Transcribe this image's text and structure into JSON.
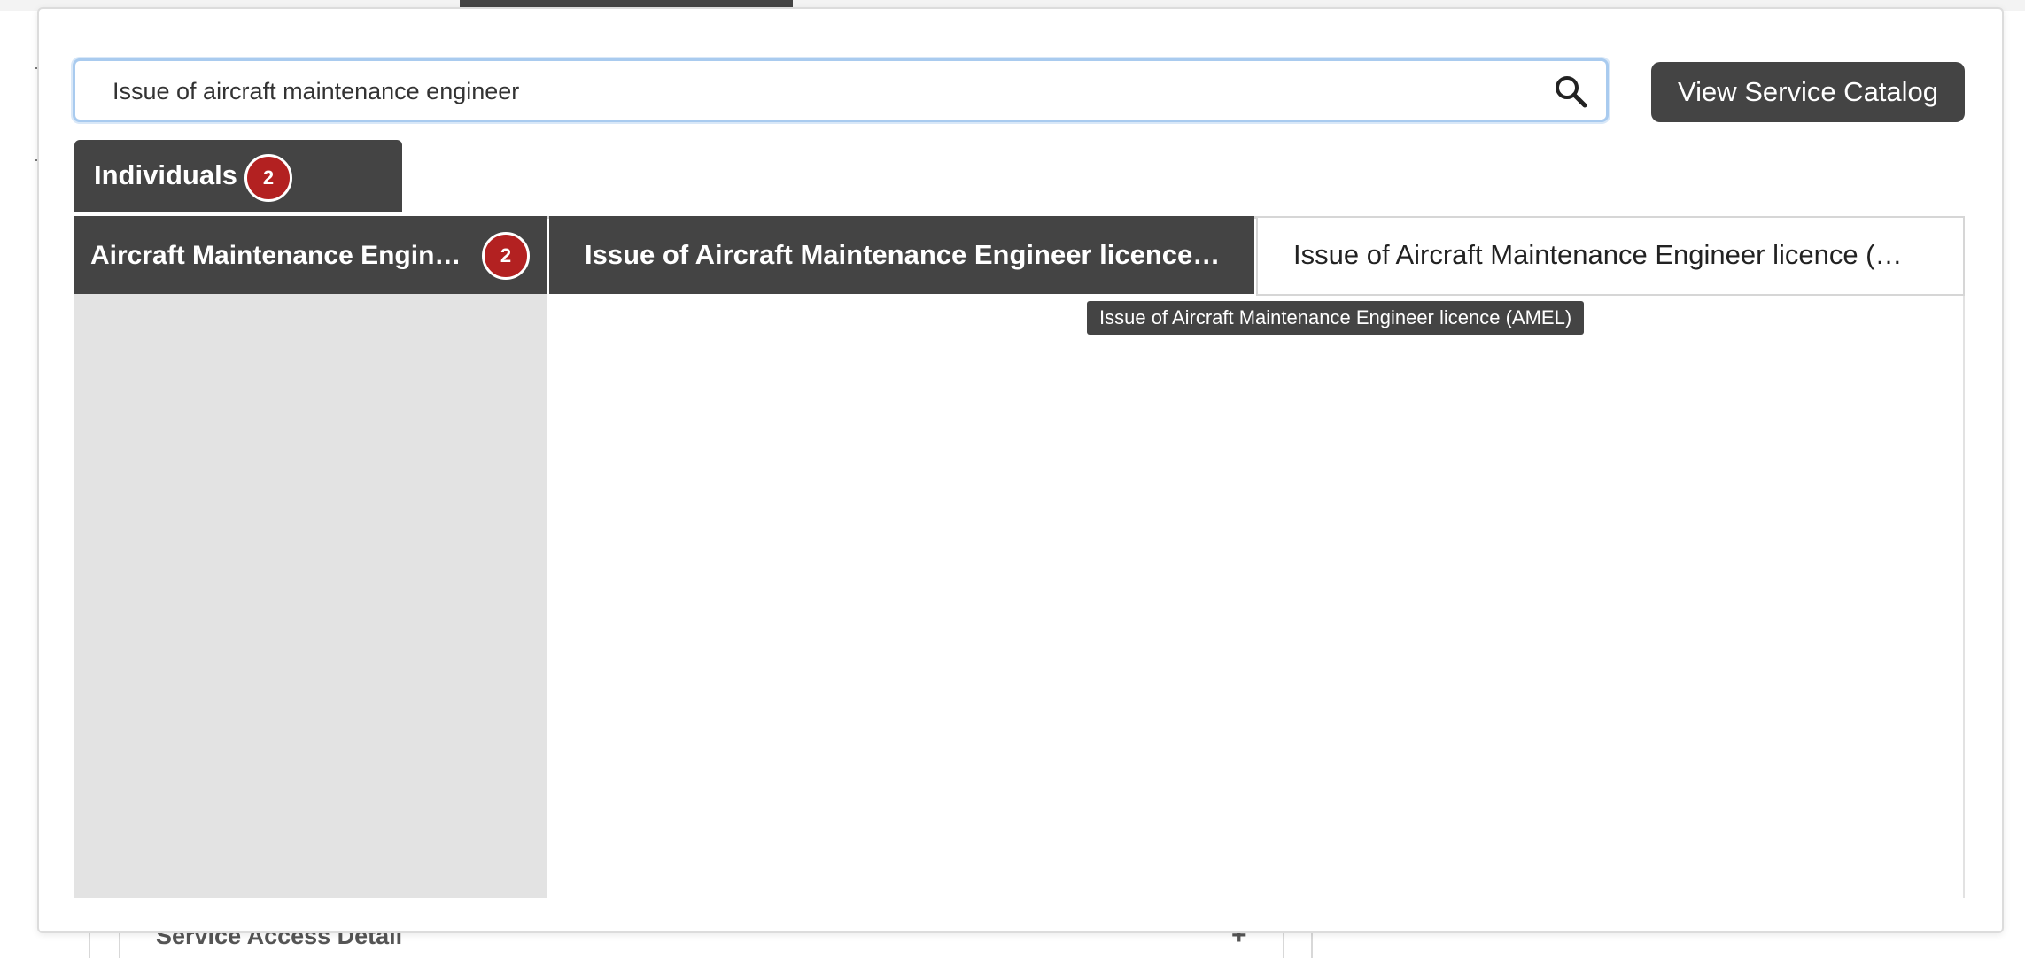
{
  "search": {
    "value": "Issue of aircraft maintenance engineer",
    "button_label": "View Service Catalog"
  },
  "audience_tab": {
    "label": "Individuals",
    "count": "2"
  },
  "category": {
    "label": "Aircraft Maintenance Engineer",
    "count": "2"
  },
  "services": [
    {
      "label": "Issue of Aircraft Maintenance Engineer licence (AMEL)"
    },
    {
      "label": "Issue of Aircraft Maintenance Engineer licence (AMEL)"
    }
  ],
  "tooltip": {
    "text": "Issue of Aircraft Maintenance Engineer licence (AMEL)"
  },
  "background": {
    "section_title": "Service Access Detail",
    "expand_symbol": "+"
  },
  "colors": {
    "dark": "#444444",
    "badge": "#b32121",
    "focus": "#a9cbef",
    "panel": "#e3e3e3"
  }
}
